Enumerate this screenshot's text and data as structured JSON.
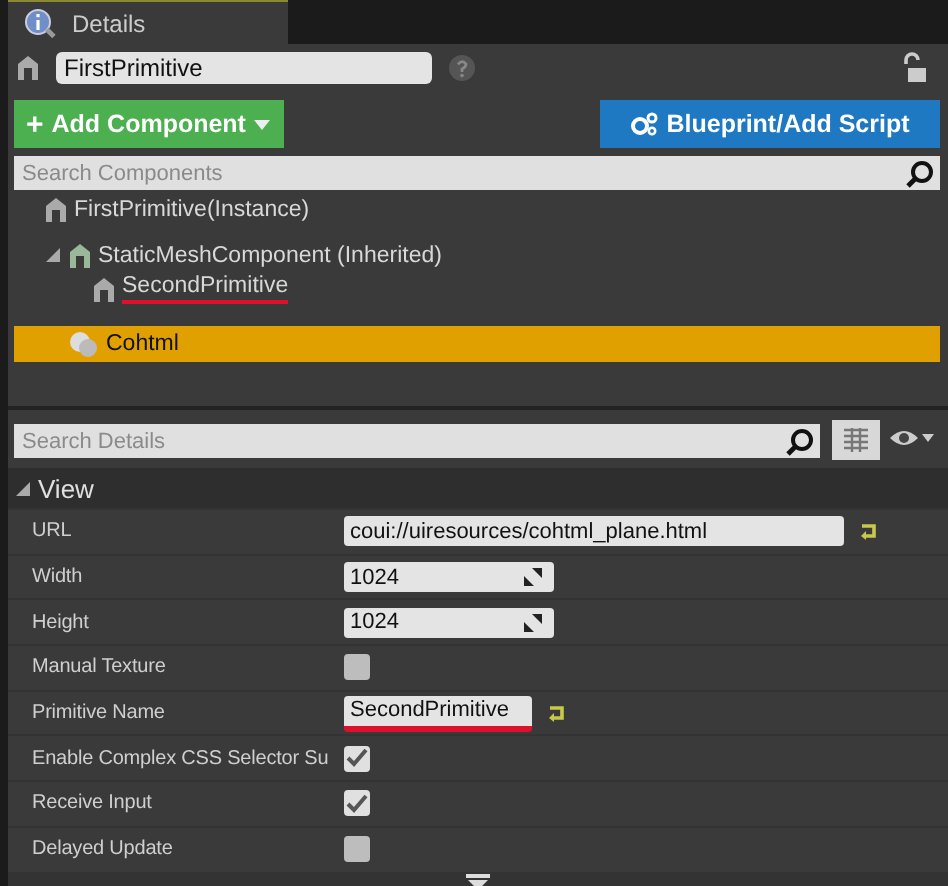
{
  "tab": {
    "title": "Details"
  },
  "actor": {
    "name": "FirstPrimitive",
    "locked": false
  },
  "buttons": {
    "add_icon": "+",
    "add": "Add Component",
    "blueprint": "Blueprint/Add Script"
  },
  "component_search": {
    "placeholder": "Search Components"
  },
  "tree": [
    {
      "label": "FirstPrimitive(Instance)",
      "kind": "actor",
      "selected": false,
      "underlined": false,
      "children": [
        {
          "label": "StaticMeshComponent (Inherited)",
          "kind": "mesh",
          "selected": false,
          "underlined": false,
          "expanded": true,
          "children": [
            {
              "label": "SecondPrimitive",
              "kind": "actor",
              "selected": false,
              "underlined": true
            }
          ]
        },
        {
          "label": "Cohtml",
          "kind": "cohtml",
          "selected": true,
          "underlined": false
        }
      ]
    }
  ],
  "details_search": {
    "placeholder": "Search Details"
  },
  "category": {
    "title": "View",
    "expanded": true
  },
  "properties": [
    {
      "kind": "text",
      "label": "URL",
      "value": "coui://uiresources/cohtml_plane.html",
      "reset": true,
      "underlined": false
    },
    {
      "kind": "number",
      "label": "Width",
      "value": "1024"
    },
    {
      "kind": "number",
      "label": "Height",
      "value": "1024"
    },
    {
      "kind": "checkbox",
      "label": "Manual Texture",
      "checked": false
    },
    {
      "kind": "text",
      "label": "Primitive Name",
      "value": "SecondPrimitive",
      "reset": true,
      "underlined": true
    },
    {
      "kind": "checkbox",
      "label": "Enable Complex CSS Selector Su",
      "checked": true
    },
    {
      "kind": "checkbox",
      "label": "Receive Input",
      "checked": true
    },
    {
      "kind": "checkbox",
      "label": "Delayed Update",
      "checked": false
    }
  ]
}
